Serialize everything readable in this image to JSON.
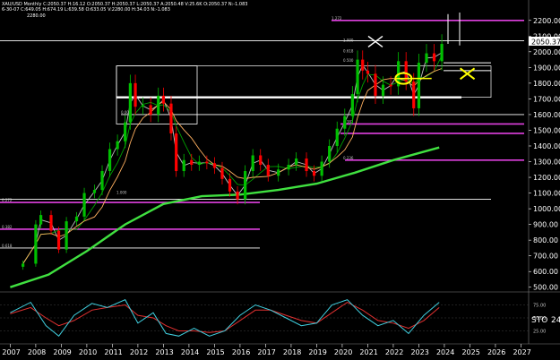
{
  "header": {
    "line1": "XAU/USD Monthly  C:2050.37  H:16.12  O:2050.37  H:2050.37  L:2050.37  A:2050.48  V:25.6K  O:2050.37  N:-1.083",
    "line2": "6-30-07  C:649.05  H:674.19  L:639.58  O:633.05  V:2280.00  H:34.03  N:-1.083",
    "line3": "2280.00"
  },
  "price_tag": "2050.37",
  "rsi_label": "STO",
  "rsi_value": "24",
  "rsi_tick_labels": [
    "75.00",
    "50.00",
    "25.00"
  ],
  "fib_labels": [
    "1.272",
    "1.000",
    "0.618",
    "0.500",
    "0.382",
    "0.236",
    "1.000",
    "0.000",
    "0.272",
    "0.382",
    "0.618"
  ],
  "colors": {
    "background": "#000000",
    "bull_candle": "#00c000",
    "bear_candle": "#ff0000",
    "ma_fast": "#c0c0c0",
    "ma_mid": "#00a000",
    "ma_slow": "#ffb060",
    "ma_long": "#40e040",
    "fib_lines": "#e040e0",
    "levels": "#ffffff",
    "marker_yellow": "#ffff00",
    "stoch": "#40d0e0",
    "stoch_signal": "#e03030",
    "axis_text": "#ffffff"
  },
  "chart_data": {
    "type": "line",
    "title": "XAU/USD Monthly",
    "xlabel": "",
    "ylabel": "",
    "x": [
      "2007",
      "2008",
      "2009",
      "2010",
      "2011",
      "2012",
      "2013",
      "2014",
      "2015",
      "2016",
      "2017",
      "2018",
      "2019",
      "2020",
      "2021",
      "2022",
      "2023",
      "2024",
      "2025",
      "2026",
      "2027"
    ],
    "ylim": [
      470,
      2250
    ],
    "yticks": [
      500,
      600,
      700,
      800,
      900,
      1000,
      1100,
      1200,
      1300,
      1400,
      1500,
      1600,
      1700,
      1800,
      1900,
      2000,
      2100,
      2200
    ],
    "series": [
      {
        "name": "",
        "type": "candle-close",
        "x": [
          2007.5,
          2008.0,
          2008.2,
          2008.6,
          2008.9,
          2009.2,
          2009.6,
          2009.9,
          2010.3,
          2010.6,
          2010.9,
          2011.2,
          2011.5,
          2011.7,
          2011.9,
          2012.2,
          2012.5,
          2012.8,
          2013.0,
          2013.3,
          2013.5,
          2013.8,
          2014.1,
          2014.4,
          2014.7,
          2015.0,
          2015.3,
          2015.6,
          2015.9,
          2016.2,
          2016.5,
          2016.8,
          2017.1,
          2017.5,
          2017.9,
          2018.2,
          2018.6,
          2018.9,
          2019.2,
          2019.5,
          2019.8,
          2020.1,
          2020.4,
          2020.6,
          2020.8,
          2021.0,
          2021.3,
          2021.6,
          2021.9,
          2022.2,
          2022.5,
          2022.8,
          2023.0,
          2023.3,
          2023.6,
          2023.9
        ],
        "values": [
          650,
          900,
          960,
          860,
          740,
          920,
          950,
          1100,
          1120,
          1240,
          1380,
          1430,
          1550,
          1800,
          1650,
          1660,
          1600,
          1720,
          1670,
          1480,
          1240,
          1310,
          1280,
          1300,
          1290,
          1260,
          1190,
          1110,
          1060,
          1240,
          1340,
          1280,
          1210,
          1250,
          1280,
          1320,
          1240,
          1210,
          1300,
          1400,
          1510,
          1590,
          1730,
          1950,
          1880,
          1860,
          1720,
          1790,
          1780,
          1940,
          1810,
          1640,
          1930,
          1990,
          1940,
          2050
        ]
      },
      {
        "name": "",
        "type": "ma-long",
        "x": [
          2007.0,
          2008.5,
          2010.0,
          2011.5,
          2013.0,
          2014.5,
          2016.0,
          2017.5,
          2019.0,
          2020.5,
          2022.0,
          2023.8
        ],
        "values": [
          500,
          580,
          730,
          900,
          1030,
          1080,
          1090,
          1120,
          1160,
          1230,
          1310,
          1390
        ]
      }
    ],
    "levels": [
      {
        "value": 2200,
        "color": "magenta"
      },
      {
        "value": 1540,
        "color": "magenta"
      },
      {
        "value": 1480,
        "color": "magenta"
      },
      {
        "value": 1310,
        "color": "magenta"
      },
      {
        "value": 1040,
        "color": "magenta"
      },
      {
        "value": 870,
        "color": "magenta"
      },
      {
        "value": 1710,
        "color": "white"
      },
      {
        "value": 1600,
        "color": "white"
      },
      {
        "value": 1060,
        "color": "white"
      },
      {
        "value": 750,
        "color": "white"
      },
      {
        "value": 2070,
        "color": "white"
      }
    ],
    "stochastic": {
      "ylim": [
        0,
        100
      ],
      "x": [
        2007.0,
        2007.8,
        2008.4,
        2008.9,
        2009.5,
        2010.2,
        2010.8,
        2011.5,
        2012.0,
        2012.6,
        2013.1,
        2013.6,
        2014.2,
        2014.8,
        2015.4,
        2016.0,
        2016.6,
        2017.2,
        2017.8,
        2018.4,
        2019.0,
        2019.6,
        2020.2,
        2020.8,
        2021.4,
        2022.0,
        2022.6,
        2023.2,
        2023.8
      ],
      "values": [
        60,
        80,
        35,
        15,
        55,
        78,
        70,
        85,
        40,
        60,
        20,
        15,
        30,
        15,
        25,
        55,
        75,
        65,
        50,
        35,
        40,
        75,
        85,
        55,
        35,
        45,
        20,
        55,
        80
      ],
      "signal": [
        58,
        70,
        50,
        35,
        45,
        65,
        70,
        75,
        55,
        50,
        35,
        25,
        25,
        22,
        25,
        45,
        65,
        65,
        55,
        45,
        40,
        60,
        80,
        65,
        45,
        40,
        30,
        45,
        70
      ]
    }
  }
}
